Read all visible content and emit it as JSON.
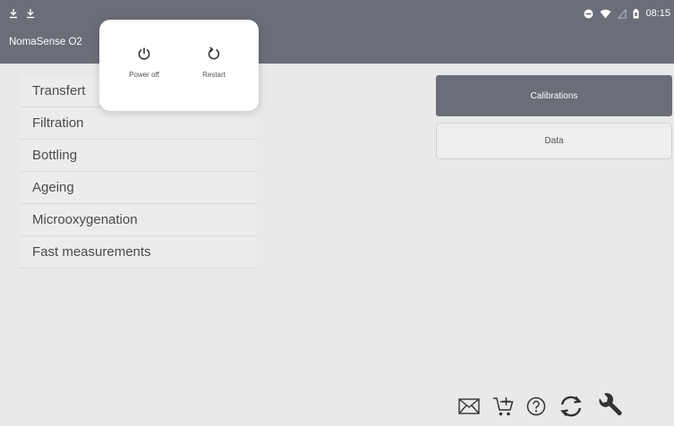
{
  "app": {
    "title": "NomaSense O2"
  },
  "status_bar": {
    "time": "08:15"
  },
  "menu": {
    "items": [
      {
        "label": "Transfert"
      },
      {
        "label": "Filtration"
      },
      {
        "label": "Bottling"
      },
      {
        "label": "Ageing"
      },
      {
        "label": "Microoxygenation"
      },
      {
        "label": "Fast measurements"
      }
    ]
  },
  "actions": {
    "calibrations_label": "Calibrations",
    "data_label": "Data"
  },
  "power_dialog": {
    "power_off_label": "Power off",
    "restart_label": "Restart"
  },
  "toolbar": {
    "icons": [
      "mail-icon",
      "cart-add-icon",
      "help-icon",
      "sync-icon",
      "wrench-icon"
    ]
  },
  "colors": {
    "accent": "#6b6d78",
    "background": "#e9e9e9"
  }
}
